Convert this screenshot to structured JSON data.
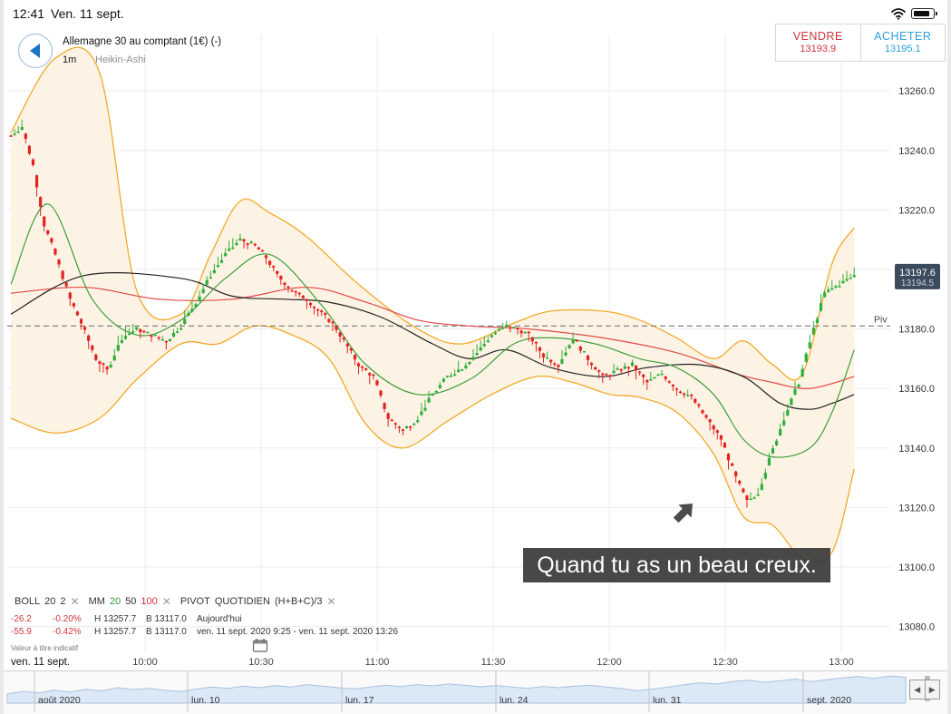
{
  "status_bar": {
    "time": "12:41",
    "date": "Ven. 11 sept."
  },
  "header": {
    "instrument": "Allemagne 30 au comptant (1€) (-)",
    "timeframe": "1m",
    "chart_type": "Heikin-Ashi"
  },
  "trade": {
    "sell_label": "VENDRE",
    "sell_price": "13193.9",
    "buy_label": "ACHETER",
    "buy_price": "13195.1"
  },
  "caption": "Quand tu as un beau creux.",
  "legend": {
    "boll": {
      "name": "BOLL",
      "p1": "20",
      "p2": "2"
    },
    "ma": {
      "name": "MM",
      "p1": "20",
      "p2": "50",
      "p3": "100"
    },
    "pivot": {
      "name": "PIVOT",
      "p1": "QUOTIDIEN",
      "p2": "(H+B+C)/3"
    },
    "remove_glyph": "✕"
  },
  "info_rows": [
    {
      "change": "-26.2",
      "pct": "-0.20%",
      "high": "H 13257.7",
      "low": "B 13117.0",
      "period": "Aujourd'hui"
    },
    {
      "change": "-55.9",
      "pct": "-0.42%",
      "high": "H 13257.7",
      "low": "B 13117.0",
      "period": "ven. 11 sept. 2020 9:25 - ven. 11 sept. 2020 13:26"
    }
  ],
  "indicative_note": "Valeur à titre indicatif",
  "current_date_label": "ven. 11 sept.",
  "time_axis": [
    "10:00",
    "10:30",
    "11:00",
    "11:30",
    "12:00",
    "12:30",
    "13:00"
  ],
  "navigator": {
    "labels": [
      "août 2020",
      "lun. 10",
      "lun. 17",
      "lun. 24",
      "lun. 31",
      "sept. 2020"
    ],
    "left_arrow": "◀",
    "right_arrow": "▶"
  },
  "colors": {
    "up": "#2eae3a",
    "down": "#e32222",
    "boll_band": "#f2a92a",
    "boll_fill": "#fdf3e4",
    "ma20": "#3d9e3d",
    "ma50": "#222222",
    "ma100": "#e04848",
    "pivot": "#777777",
    "price_tag": "#3b4a5c",
    "sell": "#d0343a",
    "buy": "#2b9fd6"
  },
  "chart_data": {
    "type": "candlestick",
    "ylim": [
      13070,
      13270
    ],
    "y_ticks": [
      "13260.0",
      "13240.0",
      "13220.0",
      "13200.0",
      "13180.0",
      "13160.0",
      "13140.0",
      "13120.0",
      "13100.0",
      "13080.0"
    ],
    "pivot": {
      "label": "Piv",
      "value": 13181
    },
    "last_price": {
      "value": 13197.6,
      "label": "13197.6",
      "sub_label": "13194.5"
    },
    "close_anchors": [
      [
        0,
        13245
      ],
      [
        3,
        13248
      ],
      [
        6,
        13235
      ],
      [
        9,
        13215
      ],
      [
        12,
        13205
      ],
      [
        16,
        13190
      ],
      [
        19,
        13182
      ],
      [
        23,
        13170
      ],
      [
        26,
        13166
      ],
      [
        30,
        13177
      ],
      [
        34,
        13180
      ],
      [
        38,
        13178
      ],
      [
        42,
        13176
      ],
      [
        46,
        13181
      ],
      [
        50,
        13189
      ],
      [
        54,
        13198
      ],
      [
        58,
        13205
      ],
      [
        62,
        13210
      ],
      [
        66,
        13208
      ],
      [
        69,
        13204
      ],
      [
        72,
        13198
      ],
      [
        76,
        13193
      ],
      [
        80,
        13190
      ],
      [
        84,
        13185
      ],
      [
        87,
        13182
      ],
      [
        90,
        13176
      ],
      [
        94,
        13168
      ],
      [
        98,
        13164
      ],
      [
        102,
        13150
      ],
      [
        106,
        13146
      ],
      [
        110,
        13150
      ],
      [
        114,
        13158
      ],
      [
        118,
        13164
      ],
      [
        122,
        13167
      ],
      [
        126,
        13172
      ],
      [
        130,
        13178
      ],
      [
        134,
        13181
      ],
      [
        137,
        13180
      ],
      [
        140,
        13178
      ],
      [
        144,
        13171
      ],
      [
        148,
        13168
      ],
      [
        152,
        13177
      ],
      [
        156,
        13170
      ],
      [
        160,
        13164
      ],
      [
        164,
        13166
      ],
      [
        168,
        13168
      ],
      [
        172,
        13162
      ],
      [
        176,
        13165
      ],
      [
        180,
        13160
      ],
      [
        184,
        13157
      ],
      [
        188,
        13150
      ],
      [
        192,
        13143
      ],
      [
        196,
        13130
      ],
      [
        199,
        13122
      ],
      [
        202,
        13125
      ],
      [
        205,
        13136
      ],
      [
        209,
        13150
      ],
      [
        213,
        13162
      ],
      [
        217,
        13180
      ],
      [
        220,
        13192
      ],
      [
        224,
        13195
      ],
      [
        228,
        13198
      ]
    ],
    "boll_upper": [
      [
        0,
        13246
      ],
      [
        12,
        13271
      ],
      [
        24,
        13266
      ],
      [
        34,
        13193
      ],
      [
        46,
        13185
      ],
      [
        54,
        13205
      ],
      [
        62,
        13223
      ],
      [
        70,
        13219
      ],
      [
        80,
        13211
      ],
      [
        94,
        13195
      ],
      [
        110,
        13180
      ],
      [
        122,
        13175
      ],
      [
        136,
        13182
      ],
      [
        146,
        13186
      ],
      [
        160,
        13186
      ],
      [
        170,
        13183
      ],
      [
        180,
        13177
      ],
      [
        190,
        13170
      ],
      [
        198,
        13176
      ],
      [
        206,
        13168
      ],
      [
        214,
        13165
      ],
      [
        222,
        13202
      ],
      [
        228,
        13214
      ]
    ],
    "boll_lower": [
      [
        0,
        13150
      ],
      [
        12,
        13145
      ],
      [
        24,
        13150
      ],
      [
        34,
        13163
      ],
      [
        46,
        13175
      ],
      [
        56,
        13175
      ],
      [
        66,
        13181
      ],
      [
        76,
        13178
      ],
      [
        86,
        13170
      ],
      [
        96,
        13148
      ],
      [
        106,
        13140
      ],
      [
        118,
        13149
      ],
      [
        130,
        13158
      ],
      [
        142,
        13164
      ],
      [
        152,
        13162
      ],
      [
        162,
        13158
      ],
      [
        170,
        13157
      ],
      [
        180,
        13152
      ],
      [
        190,
        13138
      ],
      [
        198,
        13117
      ],
      [
        206,
        13114
      ],
      [
        214,
        13103
      ],
      [
        222,
        13105
      ],
      [
        228,
        13133
      ]
    ],
    "ma20": [
      [
        0,
        13195
      ],
      [
        10,
        13222
      ],
      [
        22,
        13190
      ],
      [
        34,
        13178
      ],
      [
        46,
        13183
      ],
      [
        58,
        13197
      ],
      [
        70,
        13205
      ],
      [
        84,
        13188
      ],
      [
        96,
        13168
      ],
      [
        110,
        13158
      ],
      [
        124,
        13163
      ],
      [
        136,
        13175
      ],
      [
        146,
        13177
      ],
      [
        158,
        13175
      ],
      [
        170,
        13170
      ],
      [
        180,
        13167
      ],
      [
        190,
        13158
      ],
      [
        198,
        13143
      ],
      [
        206,
        13137
      ],
      [
        216,
        13140
      ],
      [
        222,
        13152
      ],
      [
        228,
        13173
      ]
    ],
    "ma50": [
      [
        0,
        13185
      ],
      [
        20,
        13198
      ],
      [
        46,
        13197
      ],
      [
        60,
        13191
      ],
      [
        74,
        13190
      ],
      [
        86,
        13189
      ],
      [
        100,
        13184
      ],
      [
        114,
        13175
      ],
      [
        124,
        13170
      ],
      [
        134,
        13173
      ],
      [
        146,
        13167
      ],
      [
        160,
        13164
      ],
      [
        172,
        13167
      ],
      [
        186,
        13168
      ],
      [
        198,
        13164
      ],
      [
        208,
        13155
      ],
      [
        216,
        13153
      ],
      [
        222,
        13155
      ],
      [
        228,
        13158
      ]
    ],
    "ma100": [
      [
        0,
        13192
      ],
      [
        20,
        13194
      ],
      [
        40,
        13190
      ],
      [
        60,
        13190
      ],
      [
        80,
        13194
      ],
      [
        96,
        13189
      ],
      [
        110,
        13183
      ],
      [
        124,
        13181
      ],
      [
        140,
        13180
      ],
      [
        160,
        13177
      ],
      [
        180,
        13172
      ],
      [
        196,
        13165
      ],
      [
        206,
        13162
      ],
      [
        216,
        13160
      ],
      [
        228,
        13164
      ]
    ],
    "candle_count": 229
  },
  "navigator_data": {
    "values": [
      0.3,
      0.38,
      0.33,
      0.42,
      0.36,
      0.45,
      0.4,
      0.5,
      0.44,
      0.48,
      0.42,
      0.38,
      0.46,
      0.52,
      0.48,
      0.55,
      0.5,
      0.57,
      0.52,
      0.6,
      0.55,
      0.5,
      0.46,
      0.52,
      0.58,
      0.54,
      0.6,
      0.56,
      0.62,
      0.58,
      0.53,
      0.57,
      0.52,
      0.48,
      0.54,
      0.5,
      0.55,
      0.58,
      0.52,
      0.47,
      0.4,
      0.46,
      0.52,
      0.6,
      0.66,
      0.62,
      0.7,
      0.74,
      0.68,
      0.72,
      0.78,
      0.7,
      0.76,
      0.82,
      0.86,
      0.8,
      0.88,
      0.84
    ]
  }
}
